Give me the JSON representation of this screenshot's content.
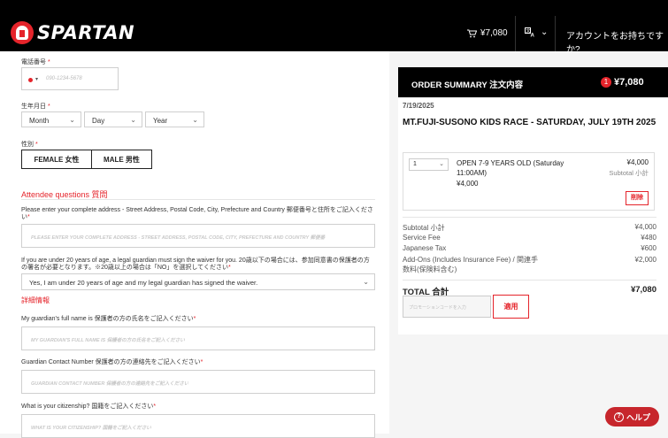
{
  "header": {
    "logo_text": "SPARTAN",
    "cart_total": "¥7,080",
    "lang_icon": "translate-icon",
    "account_text": "アカウントをお持ちですか?"
  },
  "form": {
    "phone_label": "電話番号",
    "phone_placeholder": "090-1234-5678",
    "dob_label": "生年月日",
    "dob_month": "Month",
    "dob_day": "Day",
    "dob_year": "Year",
    "gender_label": "性別",
    "gender_female": "FEMALE 女性",
    "gender_male": "MALE 男性",
    "attendee_heading": "Attendee questions 質問",
    "address_question": "Please enter your complete address - Street Address, Postal Code, City, Prefecture and Country 郵便番号と住所をご記入ください",
    "address_placeholder": "PLEASE ENTER YOUR COMPLETE ADDRESS - STREET ADDRESS, POSTAL CODE, CITY, PREFECTURE AND COUNTRY 郵便番",
    "waiver_question": "If you are under 20 years of age, a legal guardian must sign the waiver for you. 20歳以下の場合には、参加同意書の保護者の方の署名が必要となります。※20歳以上の場合は「NO」を選択してください",
    "waiver_value": "Yes, I am under 20 years of age and my legal guardian has signed the waiver.",
    "details_heading": "詳細情報",
    "guardian_name_question": "My guardian's full name is 保護者の方の氏名をご記入ください",
    "guardian_name_placeholder": "MY GUARDIAN'S FULL NAME IS 保護者の方の氏名をご記入ください",
    "guardian_contact_question": "Guardian Contact Number 保護者の方の連絡先をご記入ください",
    "guardian_contact_placeholder": "GUARDIAN CONTACT NUMBER 保護者の方の連絡先をご記入ください",
    "citizenship_question": "What is your citizenship? 国籍をご記入ください",
    "citizenship_placeholder": "WHAT IS YOUR CITIZENSHIP? 国籍をご記入ください",
    "required_mark": "*"
  },
  "summary": {
    "title": "ORDER SUMMARY 注文内容",
    "badge_count": "1",
    "header_total": "¥7,080",
    "event_date": "7/19/2025",
    "event_name": "MT.FUJI-SUSONO KIDS RACE - SATURDAY, JULY 19TH 2025",
    "item": {
      "qty": "1",
      "name": "OPEN 7-9 YEARS OLD (Saturday 11:00AM)",
      "price": "¥4,000",
      "right_price": "¥4,000",
      "subtotal_label": "Subtotal 小計",
      "delete_label": "削除"
    },
    "rows": [
      {
        "label": "Subtotal 小計",
        "value": "¥4,000"
      },
      {
        "label": "Service Fee",
        "value": "¥480"
      },
      {
        "label": "Japanese Tax",
        "value": "¥600"
      },
      {
        "label": "Add-Ons (Includes Insurance Fee) / 関連手数料(保険料含む)",
        "value": "¥2,000"
      }
    ],
    "total_label": "TOTAL 合計",
    "total_value": "¥7,080",
    "promo_placeholder": "プロモーションコードを入力",
    "apply_label": "適用"
  },
  "help": {
    "label": "ヘルプ"
  }
}
